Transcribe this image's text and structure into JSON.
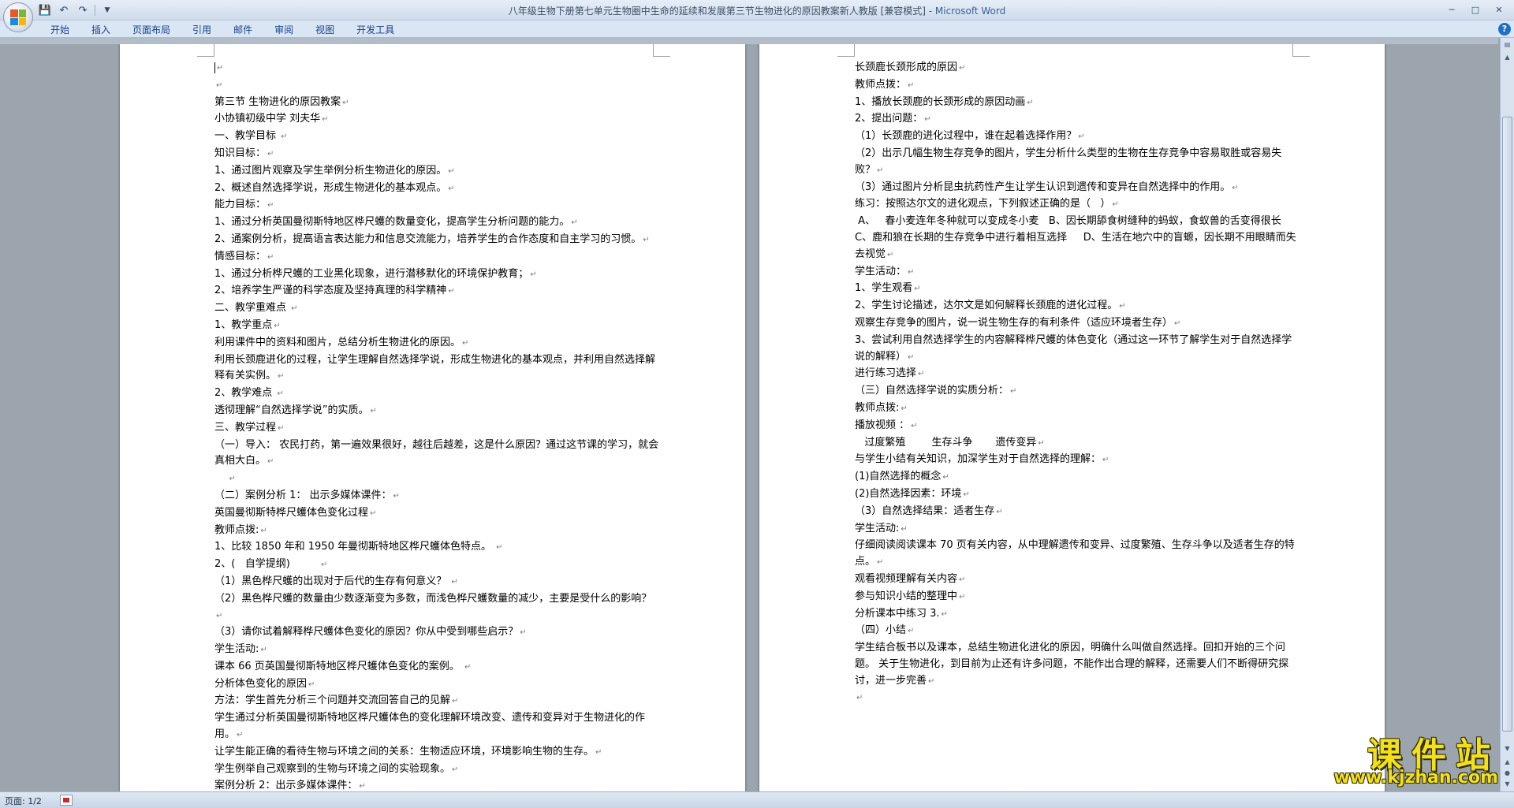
{
  "window": {
    "title_doc": "八年级生物下册第七单元生物圈中生命的延续和发展第三节生物进化的原因教案新人教版 [兼容模式] - ",
    "title_app": "Microsoft Word"
  },
  "ribbon": {
    "tabs": [
      "开始",
      "插入",
      "页面布局",
      "引用",
      "邮件",
      "审阅",
      "视图",
      "开发工具"
    ]
  },
  "status": {
    "page": "页面: 1/2"
  },
  "watermark": {
    "title": "课件站",
    "url": "www.kjzhan.com"
  },
  "pages": [
    {
      "lines": [
        "",
        "",
        "第三节 生物进化的原因教案",
        "小协镇初级中学 刘夫华",
        "一、教学目标 ",
        "知识目标：",
        "1、通过图片观察及学生举例分析生物进化的原因。",
        "2、概述自然选择学说，形成生物进化的基本观点。",
        "能力目标：",
        "1、通过分析英国曼彻斯特地区桦尺蠖的数量变化，提高学生分析问题的能力。",
        "2、通案例分析，提高语言表达能力和信息交流能力，培养学生的合作态度和自主学习的习惯。",
        "情感目标：",
        "1、通过分析桦尺蠖的工业黑化现象，进行潜移默化的环境保护教育；",
        "2、培养学生严谨的科学态度及坚持真理的科学精神",
        "二、教学重难点 ",
        "1、教学重点",
        "利用课件中的资料和图片，总结分析生物进化的原因。",
        "利用长颈鹿进化的过程，让学生理解自然选择学说，形成生物进化的基本观点，并利用自然选择解释有关实例。",
        "2、教学难点 ",
        "透彻理解“自然选择学说”的实质。",
        "三、教学过程",
        "（一）导入： 农民打药，第一遍效果很好，越往后越差，这是什么原因？通过这节课的学习，就会真相大白。",
        "    ",
        "（二）案例分析 1： 出示多媒体课件：",
        "英国曼彻斯特桦尺蠖体色变化过程",
        "教师点拨:",
        "1、比较 1850 年和 1950 年曼彻斯特地区桦尺蠖体色特点。 ",
        "2、(   自学提纲)         ",
        "（1）黑色桦尺蠖的出现对于后代的生存有何意义？ ",
        "（2）黑色桦尺蠖的数量由少数逐渐变为多数，而浅色桦尺蠖数量的减少，主要是受什么的影响？ ",
        "（3）请你试着解释桦尺蠖体色变化的原因？你从中受到哪些启示？",
        "学生活动:",
        "课本 66 页英国曼彻斯特地区桦尺蠖体色变化的案例。 ",
        "分析体色变化的原因",
        "方法：学生首先分析三个问题并交流回答自己的见解",
        "学生通过分析英国曼彻斯特地区桦尺蠖体色的变化理解环境改变、遗传和变异对于生物进化的作用。",
        "让学生能正确的看待生物与环境之间的关系：生物适应环境，环境影响生物的生存。",
        "学生例举自己观察到的生物与环境之间的实验现象。",
        "案例分析 2：出示多媒体课件："
      ]
    },
    {
      "lines": [
        "长颈鹿长颈形成的原因",
        "教师点拨：",
        "1、播放长颈鹿的长颈形成的原因动画",
        "2、提出问题：",
        "（1）长颈鹿的进化过程中，谁在起着选择作用？",
        "（2）出示几幅生物生存竞争的图片，学生分析什么类型的生物在生存竞争中容易取胜或容易失败？",
        "（3）通过图片分析昆虫抗药性产生让学生认识到遗传和变异在自然选择中的作用。",
        "练习：按照达尔文的进化观点，下列叙述正确的是（   ）",
        " A、   春小麦连年冬种就可以变成冬小麦   B、因长期舔食树缝种的蚂蚁，食蚁兽的舌变得很长          C、鹿和狼在长期的生存竞争中进行着相互选择     D、生活在地穴中的盲螈，因长期不用眼睛而失去视觉",
        "学生活动：",
        "1、学生观看",
        "2、学生讨论描述，达尔文是如何解释长颈鹿的进化过程。",
        "观察生存竞争的图片，说一说生物生存的有利条件（适应环境者生存）",
        "3、尝试利用自然选择学生的内容解释桦尺蠖的体色变化（通过这一环节了解学生对于自然选择学说的解释）",
        "进行练习选择",
        "（三）自然选择学说的实质分析：",
        "教师点拨:",
        "播放视频 ：",
        "   过度繁殖        生存斗争       遗传变异",
        "与学生小结有关知识，加深学生对于自然选择的理解：",
        "(1)自然选择的概念",
        "(2)自然选择因素：环境",
        "（3）自然选择结果：适者生存",
        "学生活动:",
        "仔细阅读阅读课本 70 页有关内容，从中理解遗传和变异、过度繁殖、生存斗争以及适者生存的特点。",
        "观看视频理解有关内容",
        "参与知识小结的整理中",
        "分析课本中练习 3.",
        "（四）小结",
        "学生结合板书以及课本，总结生物进化进化的原因，明确什么叫做自然选择。回扣开始的三个问题。 关于生物进化，到目前为止还有许多问题，不能作出合理的解释，还需要人们不断得研究探讨，进一步完善",
        ""
      ]
    }
  ]
}
